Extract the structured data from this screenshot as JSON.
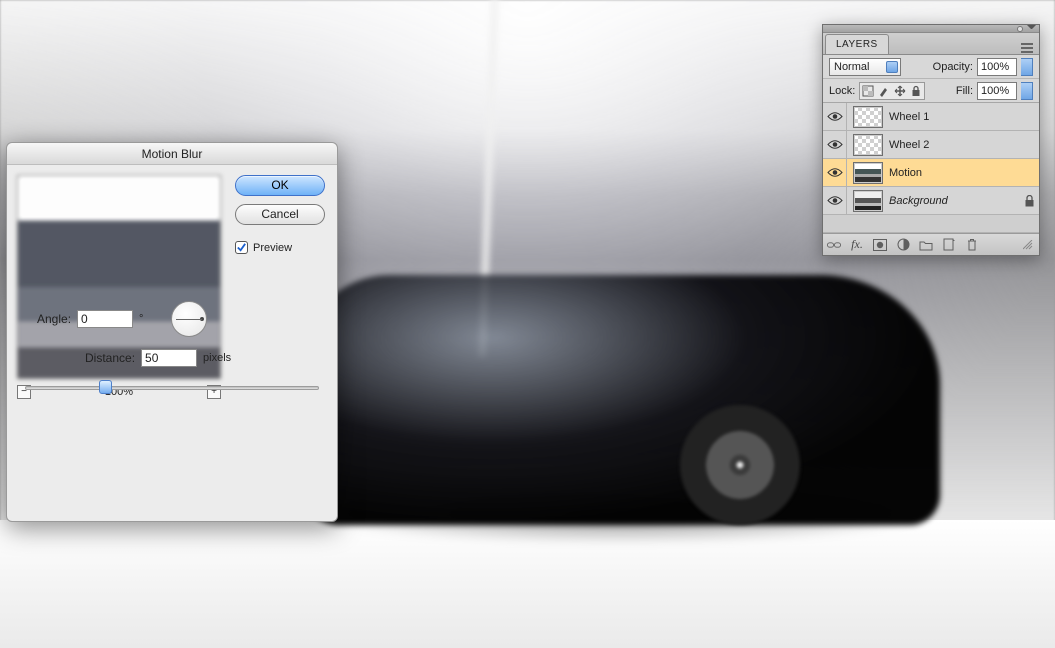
{
  "dialog": {
    "title": "Motion Blur",
    "ok_label": "OK",
    "cancel_label": "Cancel",
    "preview_label": "Preview",
    "preview_checked": true,
    "zoom_value": "100%",
    "angle_label": "Angle:",
    "angle_value": "0",
    "angle_unit": "°",
    "distance_label": "Distance:",
    "distance_value": "50",
    "distance_unit": "pixels",
    "slider_percent": 25
  },
  "layers_panel": {
    "tab_label": "LAYERS",
    "blend_mode": "Normal",
    "opacity_label": "Opacity:",
    "opacity_value": "100%",
    "lock_label": "Lock:",
    "fill_label": "Fill:",
    "fill_value": "100%",
    "layers": [
      {
        "name": "Wheel 1",
        "thumb": "checker",
        "selected": false,
        "italic": false,
        "locked": false
      },
      {
        "name": "Wheel 2",
        "thumb": "checker",
        "selected": false,
        "italic": false,
        "locked": false
      },
      {
        "name": "Motion",
        "thumb": "motion",
        "selected": true,
        "italic": false,
        "locked": false
      },
      {
        "name": "Background",
        "thumb": "bg",
        "selected": false,
        "italic": true,
        "locked": true
      }
    ]
  },
  "icons": {
    "zoom_out": "−",
    "zoom_in": "+"
  }
}
